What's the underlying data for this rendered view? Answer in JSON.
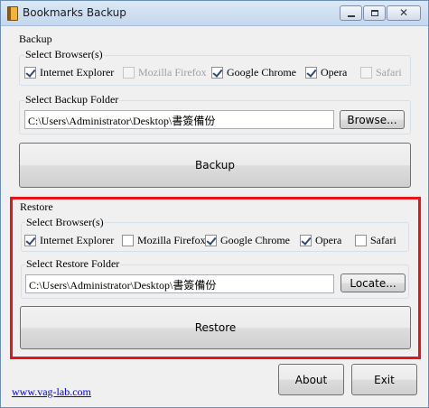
{
  "window": {
    "title": "Bookmarks Backup",
    "close_glyph": "✕"
  },
  "backup": {
    "group_label": "Backup",
    "browsers_label": "Select Browser(s)",
    "browsers": [
      {
        "label": "Internet Explorer",
        "checked": true,
        "enabled": true
      },
      {
        "label": "Mozilla Firefox",
        "checked": false,
        "enabled": false
      },
      {
        "label": "Google Chrome",
        "checked": true,
        "enabled": true
      },
      {
        "label": "Opera",
        "checked": true,
        "enabled": true
      },
      {
        "label": "Safari",
        "checked": false,
        "enabled": false
      }
    ],
    "folder_label": "Select Backup Folder",
    "folder_value": "C:\\Users\\Administrator\\Desktop\\書簽備份",
    "browse_label": "Browse...",
    "action_label": "Backup"
  },
  "restore": {
    "group_label": "Restore",
    "browsers_label": "Select Browser(s)",
    "browsers": [
      {
        "label": "Internet Explorer",
        "checked": true,
        "enabled": true
      },
      {
        "label": "Mozilla Firefox",
        "checked": false,
        "enabled": true
      },
      {
        "label": "Google Chrome",
        "checked": true,
        "enabled": true
      },
      {
        "label": "Opera",
        "checked": true,
        "enabled": true
      },
      {
        "label": "Safari",
        "checked": false,
        "enabled": true
      }
    ],
    "folder_label": "Select Restore Folder",
    "folder_value": "C:\\Users\\Administrator\\Desktop\\書簽備份",
    "locate_label": "Locate...",
    "action_label": "Restore"
  },
  "footer": {
    "link": "www.vag-lab.com",
    "about_label": "About",
    "exit_label": "Exit"
  },
  "colors": {
    "highlight": "#e8141b",
    "link": "#0000ee"
  }
}
